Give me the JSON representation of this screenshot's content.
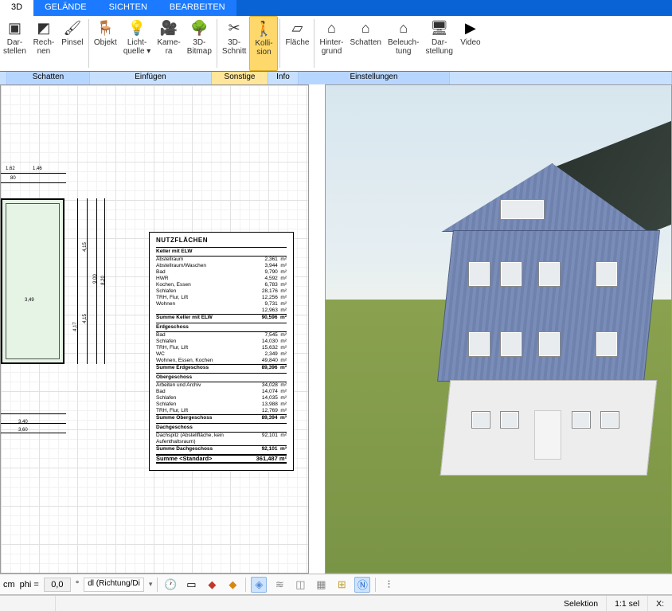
{
  "tabs": {
    "t0": "3D",
    "t1": "GELÄNDE",
    "t2": "SICHTEN",
    "t3": "BEARBEITEN"
  },
  "ribbon": {
    "darstellen": "Dar-\nstellen",
    "rechnen": "Rech-\nnen",
    "pinsel": "Pinsel",
    "objekt": "Objekt",
    "lichtquelle": "Licht-\nquelle ▾",
    "kamera": "Kame-\nra",
    "bitmap": "3D-\nBitmap",
    "schnitt": "3D-\nSchnitt",
    "kollision": "Kolli-\nsion",
    "flaeche": "Fläche",
    "hintergrund": "Hinter-\ngrund",
    "schatten": "Schatten",
    "beleuchtung": "Beleuch-\ntung",
    "darstellung": "Dar-\nstellung",
    "video": "Video"
  },
  "groups": {
    "g1": "Schatten",
    "g2": "Einfügen",
    "g3": "Sonstige",
    "g4": "Info",
    "g5": "Einstellungen"
  },
  "areatable": {
    "title": "NUTZFLÄCHEN",
    "sections": [
      {
        "header": "Keller mit ELW",
        "rows": [
          {
            "n": "Abstellraum",
            "v": "2,361",
            "u": "m²"
          },
          {
            "n": "Abstellraum/Waschen",
            "v": "3,944",
            "u": "m²"
          },
          {
            "n": "Bad",
            "v": "9,790",
            "u": "m²"
          },
          {
            "n": "HWR",
            "v": "4,592",
            "u": "m²"
          },
          {
            "n": "Kochen, Essen",
            "v": "6,783",
            "u": "m²"
          },
          {
            "n": "Schlafen",
            "v": "28,176",
            "u": "m²"
          },
          {
            "n": "TRH, Flur, Lift",
            "v": "12,256",
            "u": "m²"
          },
          {
            "n": "Wohnen",
            "v": "9,731",
            "u": "m²"
          },
          {
            "n": "",
            "v": "12,963",
            "u": "m²"
          }
        ],
        "sum": {
          "n": "Summe Keller mit ELW",
          "v": "90,596",
          "u": "m²"
        }
      },
      {
        "header": "Erdgeschoss",
        "rows": [
          {
            "n": "Bad",
            "v": "7,545",
            "u": "m²"
          },
          {
            "n": "Schlafen",
            "v": "14,030",
            "u": "m²"
          },
          {
            "n": "TRH, Flur, Lift",
            "v": "15,632",
            "u": "m²"
          },
          {
            "n": "WC",
            "v": "2,349",
            "u": "m²"
          },
          {
            "n": "Wohnen, Essen, Kochen",
            "v": "49,840",
            "u": "m²"
          }
        ],
        "sum": {
          "n": "Summe Erdgeschoss",
          "v": "89,396",
          "u": "m²"
        }
      },
      {
        "header": "Obergeschoss",
        "rows": [
          {
            "n": "Arbeiten und Archiv",
            "v": "34,028",
            "u": "m²"
          },
          {
            "n": "Bad",
            "v": "14,074",
            "u": "m²"
          },
          {
            "n": "Schlafen",
            "v": "14,035",
            "u": "m²"
          },
          {
            "n": "Schlafen",
            "v": "13,988",
            "u": "m²"
          },
          {
            "n": "TRH, Flur, Lift",
            "v": "12,769",
            "u": "m²"
          }
        ],
        "sum": {
          "n": "Summe Obergeschoss",
          "v": "89,394",
          "u": "m²"
        }
      },
      {
        "header": "Dachgeschoss",
        "rows": [
          {
            "n": "Dachspitz (Abstellfläche, kein Aufenthaltsraum)",
            "v": "92,101",
            "u": "m²"
          }
        ],
        "sum": {
          "n": "Summe Dachgeschoss",
          "v": "92,101",
          "u": "m²"
        }
      }
    ],
    "total": {
      "n": "Summe <Standard>",
      "v": "361,487 m²"
    }
  },
  "dims": {
    "d1": "1,62",
    "d2": "1,46",
    "d3": "80",
    "d4": "9,00",
    "d5": "8,20",
    "d6": "3,49",
    "d7": "4,17",
    "d8": "4,15",
    "d9": "4,15",
    "d10": "3,40",
    "d11": "3,60"
  },
  "optbar": {
    "unit": "cm",
    "phi_lbl": "phi =",
    "phi_val": "0,0",
    "deg": "°",
    "dl": "dl (Richtung/Di"
  },
  "status": {
    "sel": "Selektion",
    "scale": "1:1 sel",
    "x": "X:"
  }
}
